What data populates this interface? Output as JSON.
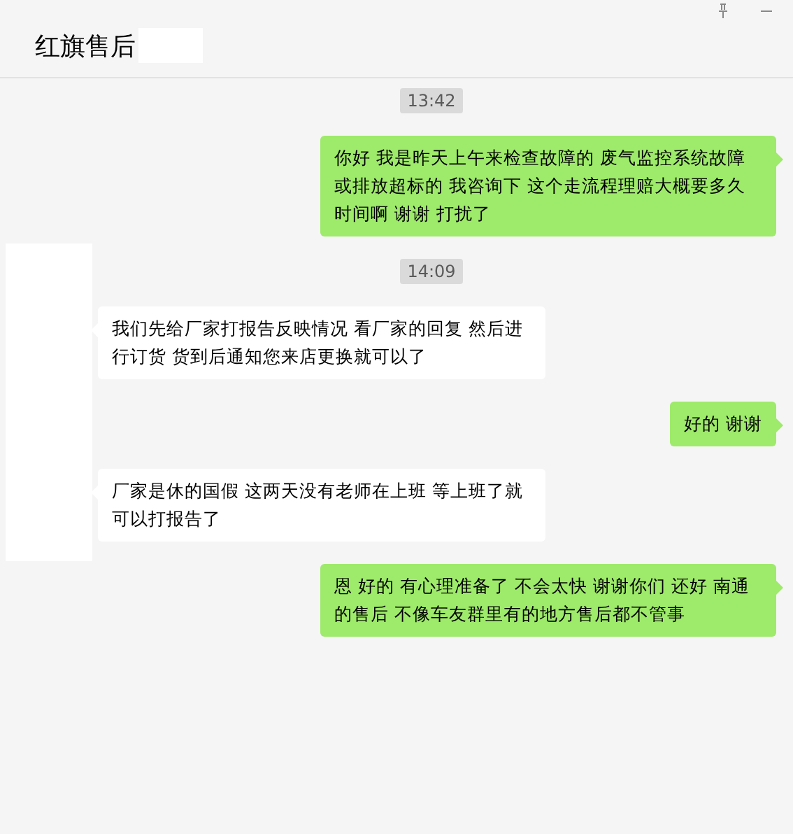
{
  "window": {
    "title": "红旗售后"
  },
  "messages": [
    {
      "kind": "time",
      "text": "13:42"
    },
    {
      "kind": "sent",
      "text": "你好 我是昨天上午来检查故障的 废气监控系统故障或排放超标的  我咨询下 这个走流程理赔大概要多久时间啊  谢谢 打扰了"
    },
    {
      "kind": "time",
      "text": "14:09"
    },
    {
      "kind": "received",
      "text": "我们先给厂家打报告反映情况 看厂家的回复  然后进行订货 货到后通知您来店更换就可以了"
    },
    {
      "kind": "sent",
      "text": "好的  谢谢"
    },
    {
      "kind": "received",
      "text": "厂家是休的国假  这两天没有老师在上班  等上班了就可以打报告了"
    },
    {
      "kind": "sent",
      "text": "恩 好的 有心理准备了 不会太快 谢谢你们 还好 南通的售后 不像车友群里有的地方售后都不管事"
    }
  ]
}
